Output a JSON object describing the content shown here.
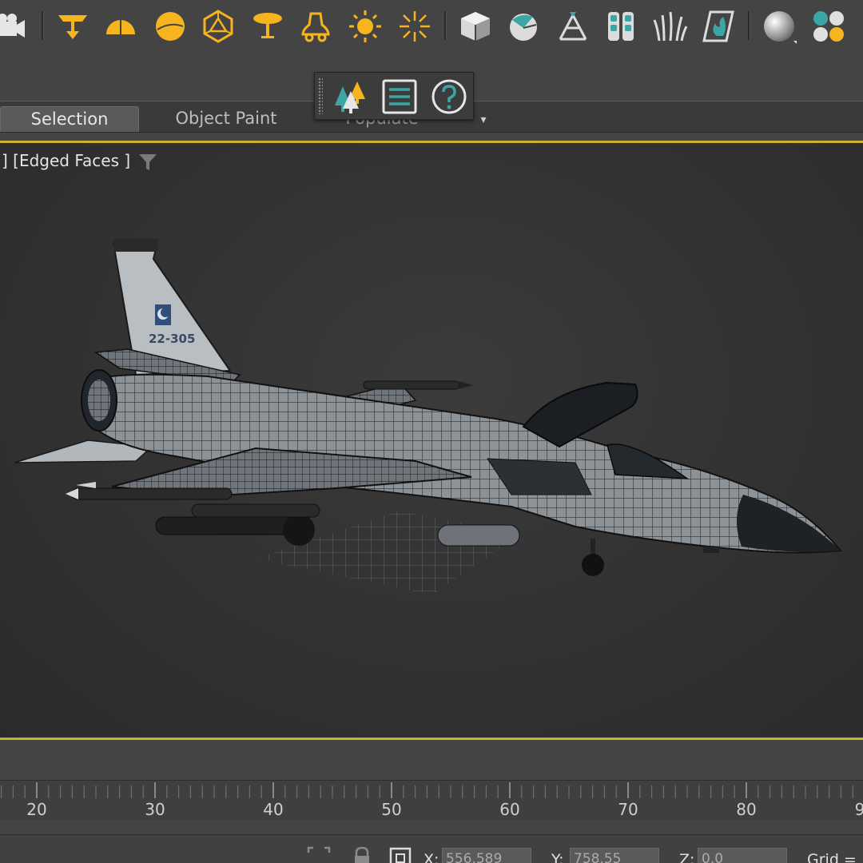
{
  "toolbar": {
    "accent": "#f6b41e",
    "icons": [
      "video-camera-icon",
      "spotlight-icon",
      "dome-light-icon",
      "sphere-light-icon",
      "geosphere-icon",
      "umbrella-light-icon",
      "bell-light-icon",
      "sun-light-icon",
      "sky-light-icon",
      "box-cube-icon",
      "sphere-clip-icon",
      "tripod-helper-icon",
      "foliage-panels-icon",
      "grass-icon",
      "fire-effect-icon",
      "material-sphere-icon",
      "material-editor-icon"
    ]
  },
  "floating_toolbar": {
    "icons": [
      "populate-trees-icon",
      "list-menu-icon",
      "help-icon"
    ]
  },
  "tabs": {
    "selection": "Selection",
    "object_paint": "Object Paint",
    "populate": "Populate",
    "extra": "▾"
  },
  "viewport": {
    "label": "] [Edged Faces ]",
    "border_color": "#c9b22f",
    "tail_marking": "22-305"
  },
  "timeline": {
    "tick_labels": [
      "20",
      "30",
      "40",
      "50",
      "60",
      "70",
      "80",
      "9"
    ]
  },
  "status": {
    "x_label": "X:",
    "x_value": "556.589",
    "y_label": "Y:",
    "y_value": "758.55",
    "z_label": "Z:",
    "z_value": "0.0",
    "grid_label": "Grid ="
  }
}
